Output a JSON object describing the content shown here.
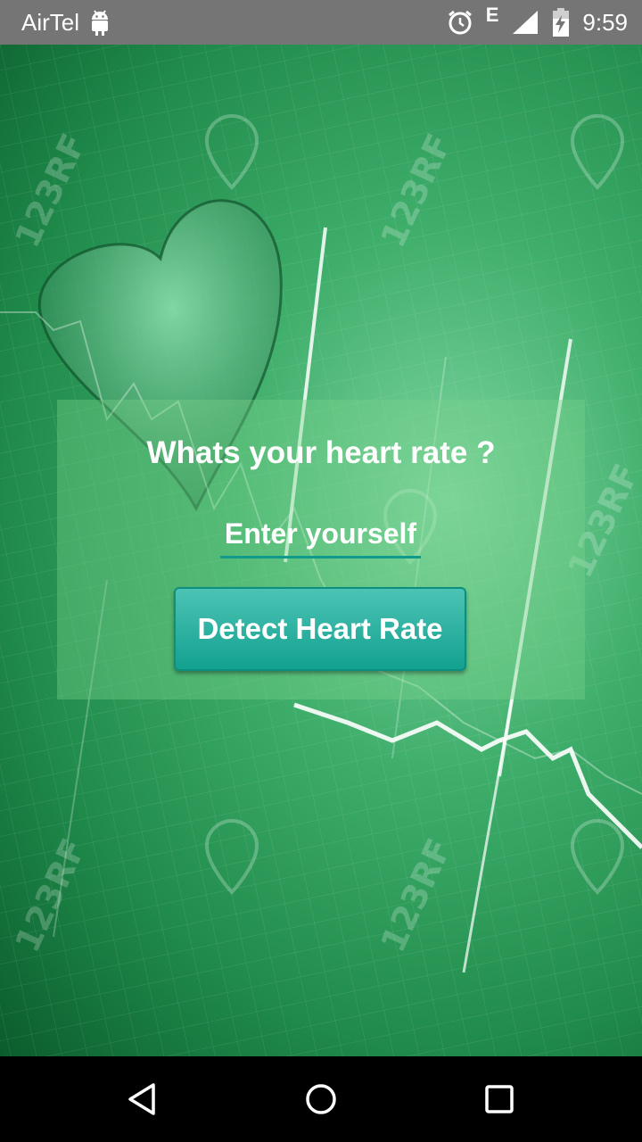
{
  "status_bar": {
    "carrier": "AirTel",
    "network_type": "E",
    "time": "9:59",
    "icons": [
      "android-icon",
      "alarm-icon",
      "signal-icon",
      "battery-charging-icon"
    ]
  },
  "background": {
    "watermark": "123RF"
  },
  "card": {
    "question": "Whats your heart rate ?",
    "input_placeholder": "Enter yourself",
    "detect_button_label": "Detect Heart Rate"
  },
  "nav_bar": {
    "icons": [
      "back-icon",
      "home-icon",
      "recent-apps-icon"
    ]
  },
  "colors": {
    "status_bar": "#757575",
    "accent_teal": "#13a190",
    "background_green": "#2e9c5a"
  }
}
